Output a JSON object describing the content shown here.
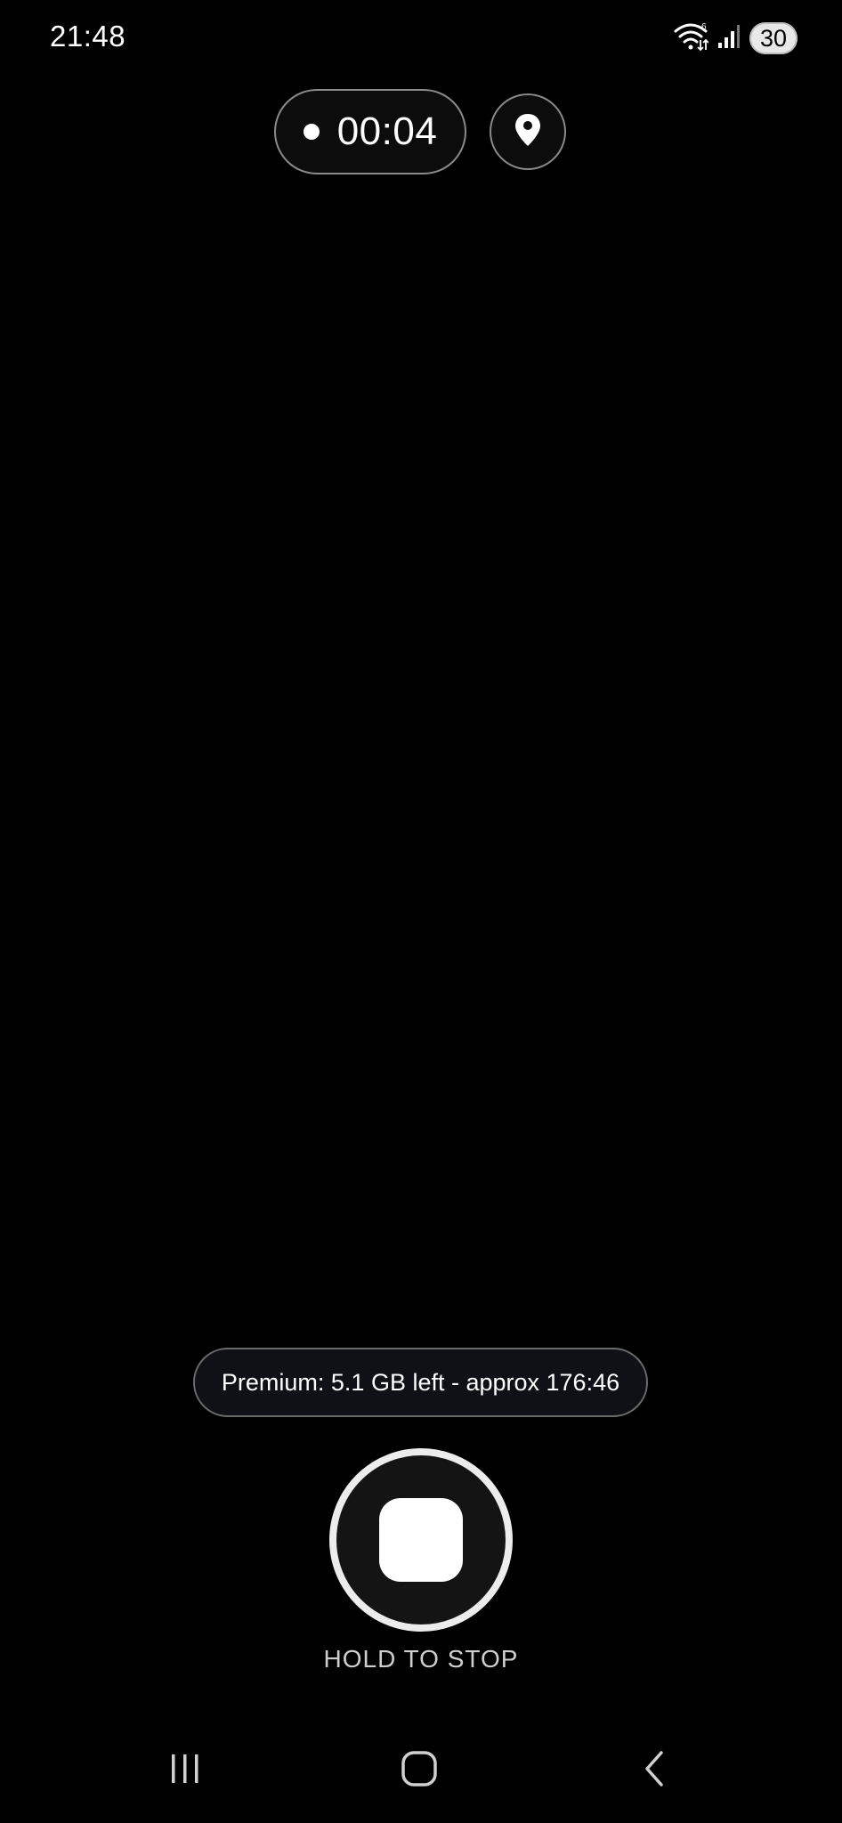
{
  "status_bar": {
    "time": "21:48",
    "battery_level": "30",
    "icons": [
      "wifi-icon",
      "signal-icon",
      "battery-icon"
    ]
  },
  "recording": {
    "indicator_icon": "record-dot-icon",
    "elapsed": "00:04",
    "location_icon": "location-pin-icon"
  },
  "storage": {
    "text": "Premium: 5.1 GB left - approx 176:46"
  },
  "controls": {
    "stop_icon": "stop-icon",
    "hold_label": "HOLD TO STOP"
  },
  "nav": {
    "items": [
      "recent-apps-icon",
      "home-icon",
      "back-icon"
    ]
  },
  "colors": {
    "background": "#000000",
    "foreground": "#ffffff",
    "border": "#8a8a8a",
    "pill_background": "#0f1116"
  }
}
